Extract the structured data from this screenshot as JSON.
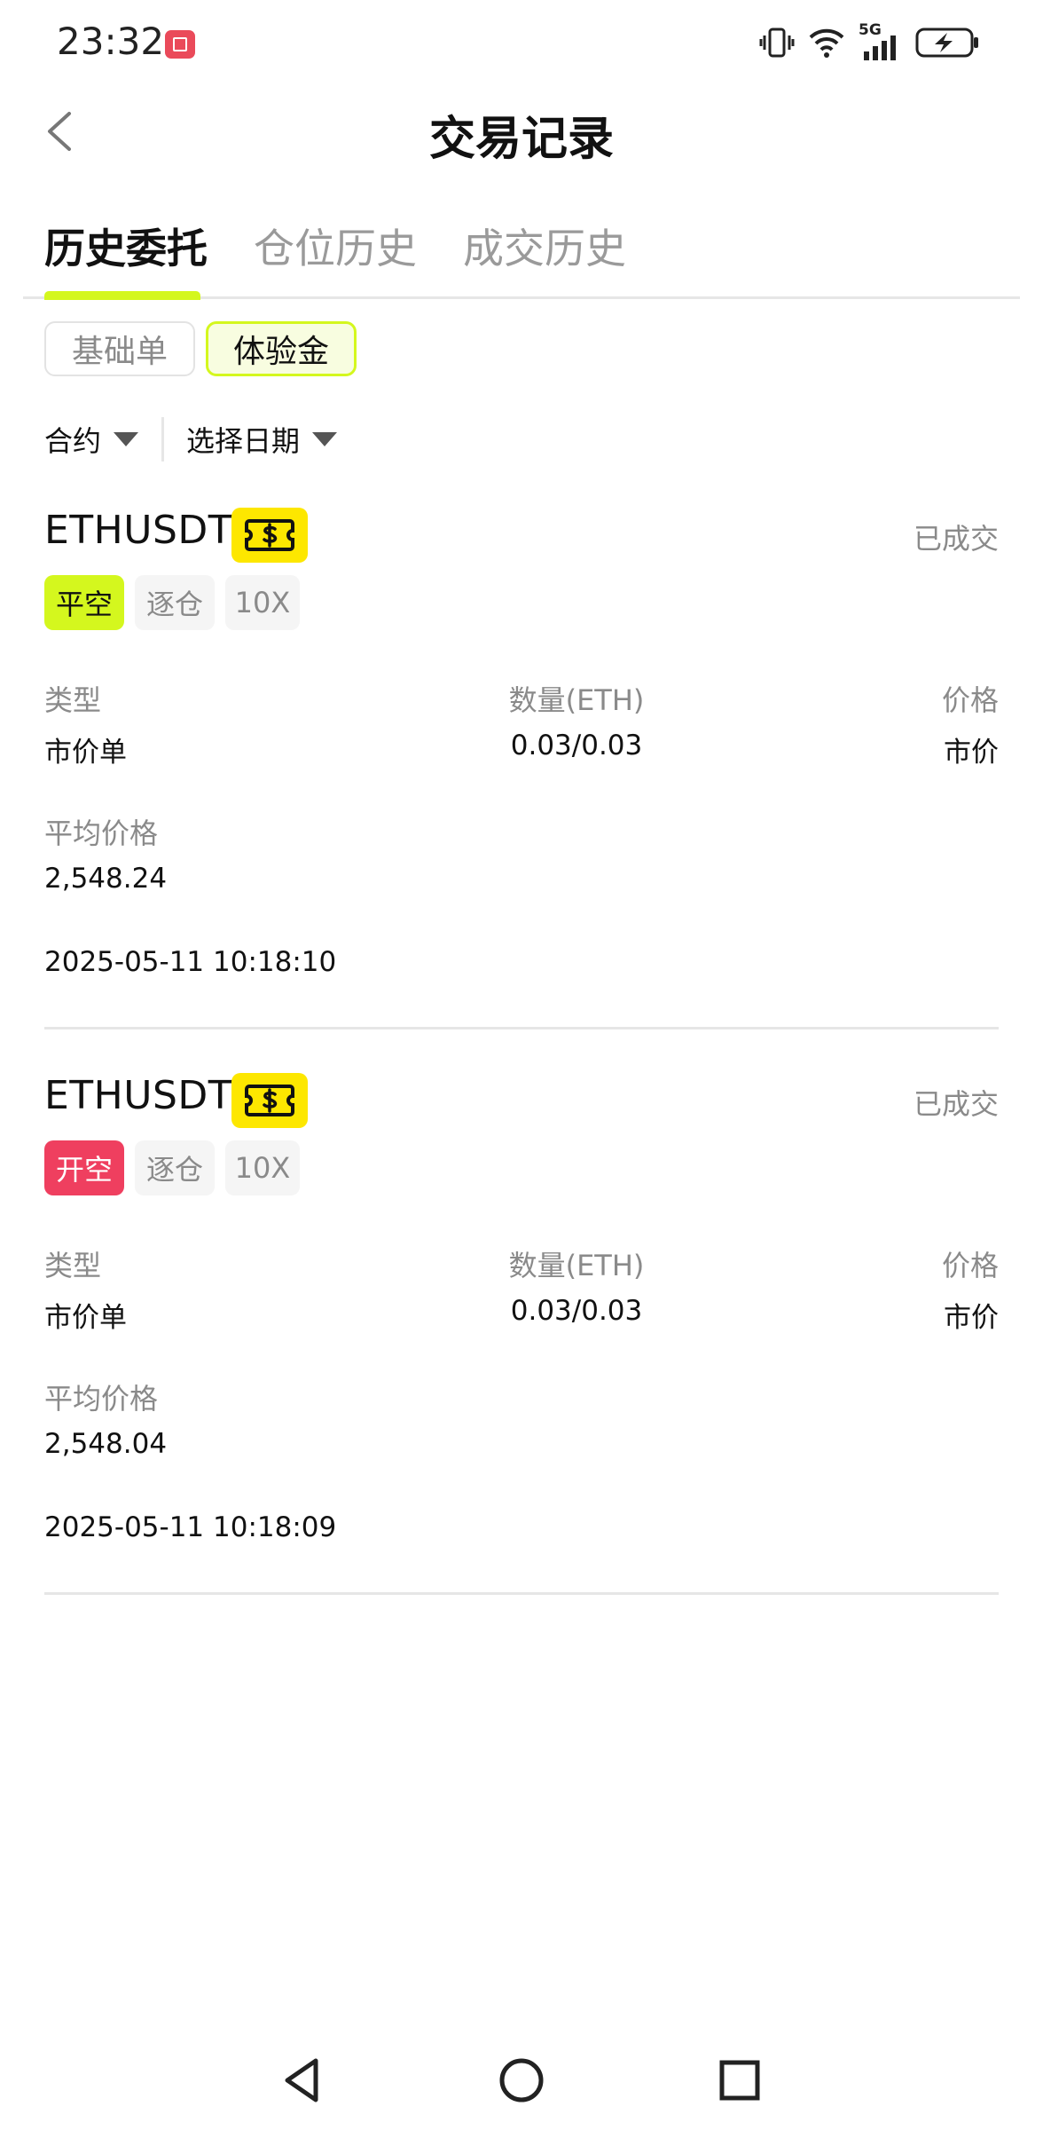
{
  "status_bar": {
    "time": "23:32",
    "network": "5G",
    "icons": [
      "vibrate-icon",
      "wifi-icon",
      "signal-icon",
      "battery-charging-icon"
    ]
  },
  "header": {
    "title": "交易记录",
    "back_icon": "chevron-left-icon"
  },
  "tabs": [
    {
      "label": "历史委托",
      "active": true
    },
    {
      "label": "仓位历史",
      "active": false
    },
    {
      "label": "成交历史",
      "active": false
    }
  ],
  "subtabs": [
    {
      "label": "基础单",
      "active": false
    },
    {
      "label": "体验金",
      "active": true
    }
  ],
  "filters": {
    "contract_label": "合约",
    "date_label": "选择日期"
  },
  "field_labels": {
    "type": "类型",
    "quantity": "数量(ETH)",
    "price": "价格",
    "avg_price": "平均价格"
  },
  "orders": [
    {
      "symbol": "ETHUSDT",
      "status": "已成交",
      "side": "平空",
      "margin_mode": "逐仓",
      "leverage": "10X",
      "type": "市价单",
      "quantity": "0.03/0.03",
      "price": "市价",
      "avg_price": "2,548.24",
      "time": "2025-05-11 10:18:10"
    },
    {
      "symbol": "ETHUSDT",
      "status": "已成交",
      "side": "开空",
      "margin_mode": "逐仓",
      "leverage": "10X",
      "type": "市价单",
      "quantity": "0.03/0.03",
      "price": "市价",
      "avg_price": "2,548.04",
      "time": "2025-05-11 10:18:09"
    }
  ],
  "colors": {
    "accent_lime": "#d4f71e",
    "bonus_yellow": "#fde700",
    "open_short_red": "#ef3f5f",
    "muted_text": "#8a8a8a"
  }
}
